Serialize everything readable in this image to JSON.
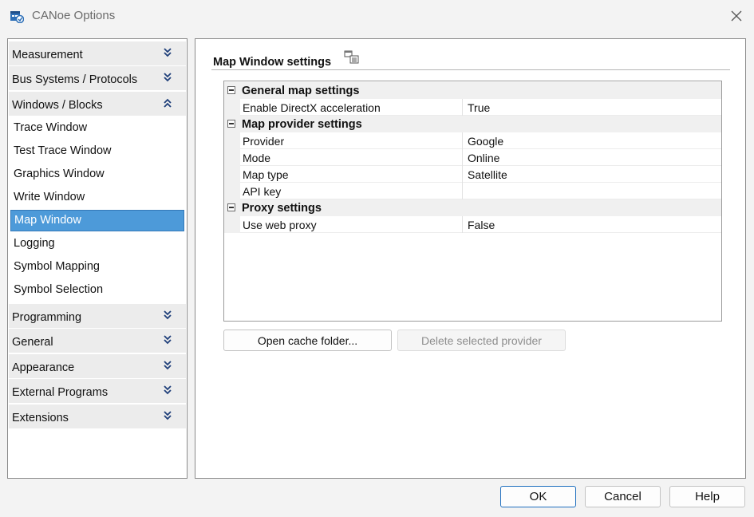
{
  "window": {
    "title": "CANoe Options"
  },
  "nav": {
    "groups_top": [
      {
        "label": "Measurement",
        "expanded": false
      },
      {
        "label": "Bus Systems / Protocols",
        "expanded": false
      },
      {
        "label": "Windows / Blocks",
        "expanded": true
      }
    ],
    "items": [
      {
        "label": "Trace Window"
      },
      {
        "label": "Test Trace Window"
      },
      {
        "label": "Graphics Window"
      },
      {
        "label": "Write Window"
      },
      {
        "label": "Map Window",
        "selected": true
      },
      {
        "label": "Logging"
      },
      {
        "label": "Symbol Mapping"
      },
      {
        "label": "Symbol Selection"
      }
    ],
    "groups_bottom": [
      {
        "label": "Programming",
        "expanded": false
      },
      {
        "label": "General",
        "expanded": false
      },
      {
        "label": "Appearance",
        "expanded": false
      },
      {
        "label": "External Programs",
        "expanded": false
      },
      {
        "label": "Extensions",
        "expanded": false
      }
    ]
  },
  "content": {
    "title": "Map Window settings",
    "sections": [
      {
        "label": "General map settings",
        "props": [
          {
            "name": "Enable DirectX acceleration",
            "value": "True"
          }
        ]
      },
      {
        "label": "Map provider settings",
        "props": [
          {
            "name": "Provider",
            "value": "Google"
          },
          {
            "name": "Mode",
            "value": "Online"
          },
          {
            "name": "Map type",
            "value": "Satellite"
          },
          {
            "name": "API key",
            "value": ""
          }
        ]
      },
      {
        "label": "Proxy settings",
        "props": [
          {
            "name": "Use web proxy",
            "value": "False"
          }
        ]
      }
    ],
    "open_cache_label": "Open cache folder...",
    "delete_provider_label": "Delete selected provider"
  },
  "footer": {
    "ok_label": "OK",
    "cancel_label": "Cancel",
    "help_label": "Help"
  },
  "colors": {
    "selection": "#4d9ad9",
    "primary_border": "#1f6fbf"
  }
}
